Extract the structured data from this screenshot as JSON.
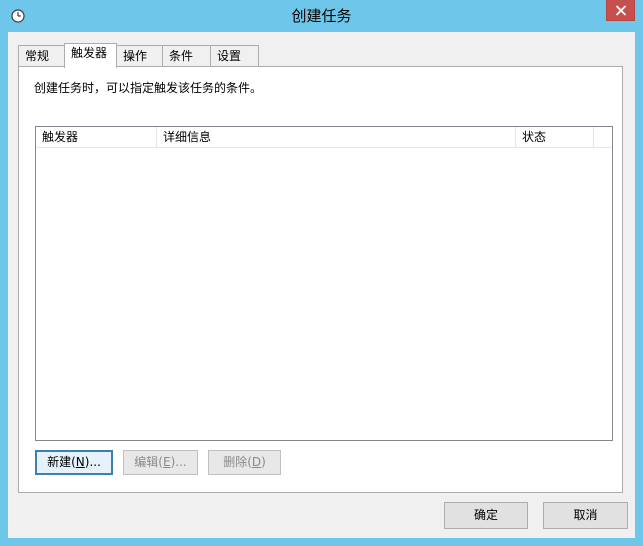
{
  "window": {
    "title": "创建任务",
    "icon": "clock-icon",
    "close_icon": "close-icon"
  },
  "tabs": [
    {
      "label": "常规",
      "active": false
    },
    {
      "label": "触发器",
      "active": true
    },
    {
      "label": "操作",
      "active": false
    },
    {
      "label": "条件",
      "active": false
    },
    {
      "label": "设置",
      "active": false
    }
  ],
  "triggers_panel": {
    "description": "创建任务时，可以指定触发该任务的条件。",
    "columns": [
      "触发器",
      "详细信息",
      "状态"
    ],
    "rows": [],
    "buttons": {
      "new": {
        "pre": "新建(",
        "key": "N",
        "post": ")..."
      },
      "edit": {
        "pre": "编辑(",
        "key": "E",
        "post": ")..."
      },
      "delete": {
        "pre": "删除(",
        "key": "D",
        "post": ")"
      }
    }
  },
  "footer": {
    "ok_label": "确定",
    "cancel_label": "取消"
  },
  "colors": {
    "titlebar": "#6ec6ea",
    "close": "#c7504e",
    "dialog_bg": "#f0f0f0",
    "panel_bg": "#ffffff"
  }
}
